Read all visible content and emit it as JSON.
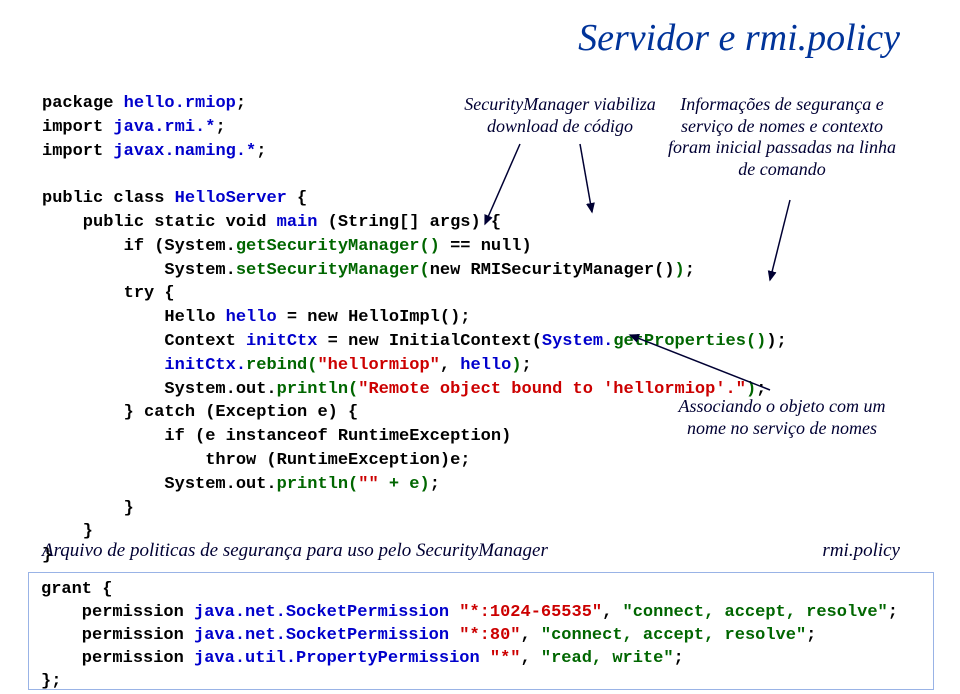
{
  "title": "Servidor e rmi.policy",
  "code": {
    "l1a": "package ",
    "l1b": "hello.rmiop",
    "l1c": ";",
    "l2a": "import ",
    "l2b": "java.rmi.*",
    "l2c": ";",
    "l3a": "import ",
    "l3b": "javax.naming.*",
    "l3c": ";",
    "l4": "",
    "l5a": "public class ",
    "l5b": "HelloServer",
    "l5c": " {",
    "l6a": "    public static void ",
    "l6b": "main",
    "l6c": " (String[] args) {",
    "l7a": "        if (System.",
    "l7b": "getSecurityManager()",
    "l7c": " == null)",
    "l8a": "            System.",
    "l8b": "setSecurityManager(",
    "l8c": "new RMISecurityManager()",
    "l8d": ")",
    "l8e": ";",
    "l9": "        try {",
    "l10a": "            Hello ",
    "l10b": "hello",
    "l10c": " = new HelloImpl();",
    "l11a": "            Context ",
    "l11b": "initCtx",
    "l11c": " = new InitialContext(",
    "l11d": "System.",
    "l11e": "getProperties()",
    "l11f": ");",
    "l12a": "            ",
    "l12b": "initCtx.",
    "l12c": "rebind(",
    "l12d": "\"hellormiop\"",
    "l12e": ", ",
    "l12f": "hello",
    "l12g": ")",
    "l12h": ";",
    "l13a": "            System.out.",
    "l13b": "println(",
    "l13c": "\"Remote object bound to 'hellormiop'.\"",
    "l13d": ")",
    "l13e": ";",
    "l14": "        } catch (Exception e) {",
    "l15": "            if (e instanceof RuntimeException)",
    "l16": "                throw (RuntimeException)e;",
    "l17a": "            System.out.",
    "l17b": "println(",
    "l17c": "\"\"",
    "l17d": " + e)",
    "l17e": ";",
    "l18": "        }",
    "l19": "    }",
    "l20": "}"
  },
  "anno1": "SecurityManager viabiliza download de código",
  "anno2": "Informações de segurança e serviço de nomes e contexto foram inicial passadas na linha de comando",
  "anno3": "Associando o objeto com um nome no serviço de nomes",
  "policyLabel": "Arquivo de politicas de segurança para uso pelo SecurityManager",
  "rmipolicy": "rmi.policy",
  "policy": {
    "p1": "grant {",
    "p2a": "    permission ",
    "p2b": "java.net.SocketPermission",
    "p2c": " ",
    "p2d": "\"*:1024-65535\"",
    "p2e": ", ",
    "p2f": "\"connect, accept, resolve\"",
    "p2g": ";",
    "p3a": "    permission ",
    "p3b": "java.net.SocketPermission",
    "p3c": " ",
    "p3d": "\"*:80\"",
    "p3e": ", ",
    "p3f": "\"connect, accept, resolve\"",
    "p3g": ";",
    "p4a": "    permission ",
    "p4b": "java.util.PropertyPermission",
    "p4c": " ",
    "p4d": "\"*\"",
    "p4e": ", ",
    "p4f": "\"read, write\"",
    "p4g": ";",
    "p5": "};"
  }
}
